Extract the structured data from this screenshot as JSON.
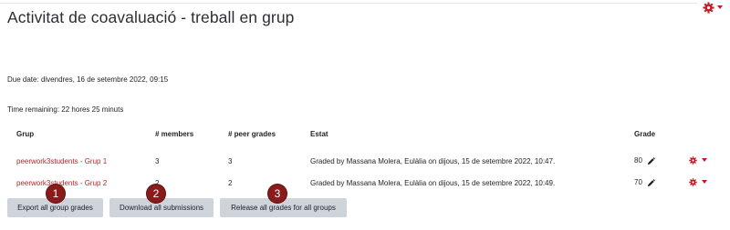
{
  "page": {
    "title": "Activitat de coavaluació - treball en grup"
  },
  "due": {
    "label": "Due date:",
    "value": "divendres, 16 de setembre 2022, 09:15"
  },
  "remaining": {
    "label": "Time remaining:",
    "value": "22 hores 25 minuts"
  },
  "table": {
    "headers": [
      "Grup",
      "# members",
      "# peer grades",
      "Estat",
      "Grade"
    ],
    "rows": [
      {
        "group": "peerwork3students - Grup 1",
        "members": "3",
        "peer_grades": "3",
        "status": "Graded by Massana Molera, Eulàlia on dijous, 15 de setembre 2022, 10:47.",
        "grade": "80"
      },
      {
        "group": "peerwork3students - Grup 2",
        "members": "2",
        "peer_grades": "2",
        "status": "Graded by Massana Molera, Eulàlia on dijous, 15 de setembre 2022, 10:49.",
        "grade": "70"
      }
    ]
  },
  "buttons": {
    "export": "Export all group grades",
    "download": "Download all submissions",
    "release": "Release all grades for all groups"
  },
  "markers": [
    "1",
    "2",
    "3"
  ],
  "colors": {
    "accent": "#c71c27",
    "marker": "#8b1a1a",
    "button": "#ced4da"
  },
  "icons": {
    "header_menu": "gear-icon",
    "row_menu": "gear-icon",
    "edit_grade": "pencil-icon"
  }
}
